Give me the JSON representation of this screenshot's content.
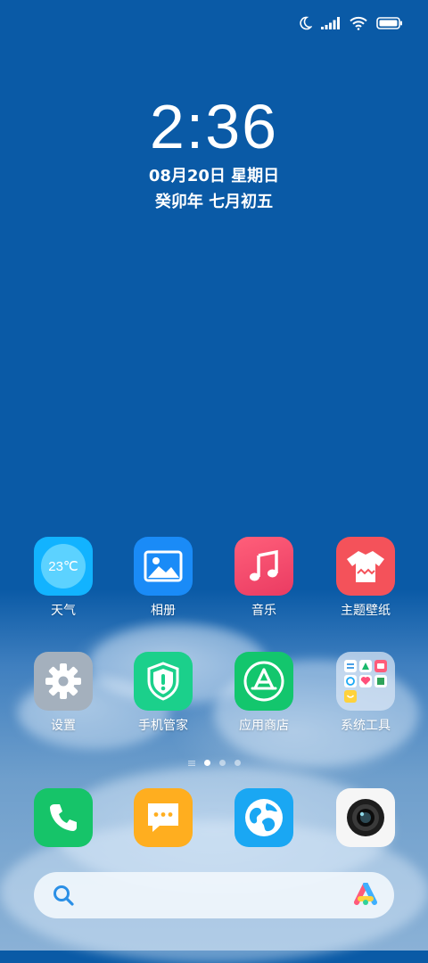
{
  "status": {
    "icons": [
      "moon-icon",
      "signal-icon",
      "wifi-icon",
      "battery-icon"
    ]
  },
  "clock": {
    "time": "2:36",
    "date": "08月20日 星期日",
    "lunar": "癸卯年 七月初五"
  },
  "apps": [
    {
      "label": "天气",
      "icon": "weather-icon",
      "temp": "23℃",
      "color": "#1fb6ff"
    },
    {
      "label": "相册",
      "icon": "gallery-icon",
      "color": "#1d8cf8"
    },
    {
      "label": "音乐",
      "icon": "music-icon",
      "color": "#f24f6b"
    },
    {
      "label": "主题壁纸",
      "icon": "theme-icon",
      "color": "#f5525b"
    },
    {
      "label": "设置",
      "icon": "settings-icon",
      "color": "#9aa8b8"
    },
    {
      "label": "手机管家",
      "icon": "security-icon",
      "color": "#1ccf8a"
    },
    {
      "label": "应用商店",
      "icon": "appstore-icon",
      "color": "#14c86f"
    },
    {
      "label": "系统工具",
      "icon": "folder-icon",
      "color": "#cfdaea"
    }
  ],
  "dock": [
    {
      "icon": "phone-icon",
      "color": "#18c46a"
    },
    {
      "icon": "messages-icon",
      "color": "#ffae21"
    },
    {
      "icon": "browser-icon",
      "color": "#1ba9f5"
    },
    {
      "icon": "camera-icon",
      "color": "#f4f4f4"
    }
  ],
  "page_indicator": {
    "pages": 3,
    "current": 1
  },
  "search": {
    "search_icon": "search-icon",
    "assistant_icon": "assistant-icon"
  }
}
